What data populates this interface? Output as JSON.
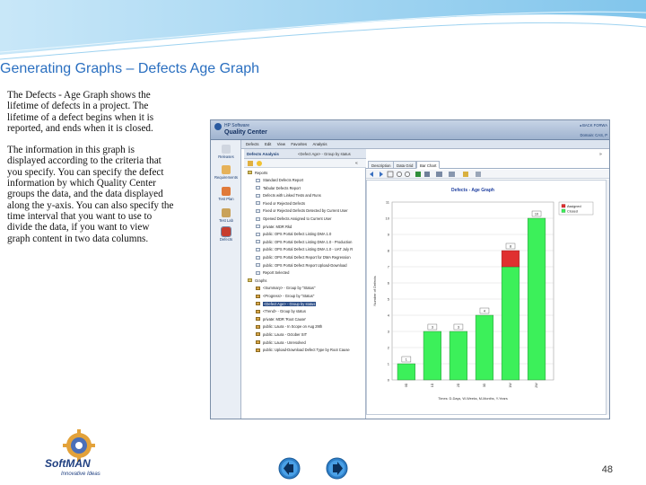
{
  "slide": {
    "title": "Generating Graphs – Defects Age Graph",
    "paragraphs": [
      "The Defects - Age Graph shows the lifetime of defects in a project. The lifetime of a defect begins when it is reported, and ends when it is closed.",
      "The information in this graph is displayed according to the criteria that you specify. You can specify the defect information by which Quality Center groups the data, and the data displayed along the y-axis. You can also specify the time interval that you want to use to divide the data, if you want to view graph content in two data columns."
    ],
    "page_number": "48",
    "logo_text": "SoftMAN",
    "logo_tagline": "Innovative Ideas"
  },
  "app": {
    "brand_small": "HP Software",
    "brand_large": "Quality Center",
    "nav_text": "◂ BACK   FORWA",
    "domain_text": "Domain: CAS, P",
    "sidebar": [
      "Releases",
      "Requirements",
      "Test Plan",
      "Test Lab",
      "Defects"
    ],
    "menubar": [
      "Defects",
      "Edit",
      "View",
      "Favorites",
      "Analysis"
    ],
    "left_pane": {
      "title": "Defects Analysis",
      "subtitle": "<Defect Age> - Group by status",
      "tree": [
        {
          "label": "Reports",
          "indent": 0,
          "kind": "folder",
          "selected": false
        },
        {
          "label": "Standard Defects Report",
          "indent": 1,
          "kind": "report",
          "selected": false
        },
        {
          "label": "Tabular Defects Report",
          "indent": 1,
          "kind": "report",
          "selected": false
        },
        {
          "label": "Defects with Linked Tests and Runs",
          "indent": 1,
          "kind": "report",
          "selected": false
        },
        {
          "label": "Fixed or Rejected Defects",
          "indent": 1,
          "kind": "report",
          "selected": false
        },
        {
          "label": "Fixed or Rejected Defects Detected by Current User",
          "indent": 1,
          "kind": "report",
          "selected": false
        },
        {
          "label": "Opened Defects Assigned to Current User",
          "indent": 1,
          "kind": "report",
          "selected": false
        },
        {
          "label": "private: MDR Rkd",
          "indent": 1,
          "kind": "report",
          "selected": false
        },
        {
          "label": "public: OPS Portal Defect Listing DMA 1.0",
          "indent": 1,
          "kind": "report",
          "selected": false
        },
        {
          "label": "public: OPS Portal Defect Listing DMA 1.0 - Production",
          "indent": 1,
          "kind": "report",
          "selected": false
        },
        {
          "label": "public: OPS Portal Defect Listing DMA 1.0 - UAT July R",
          "indent": 1,
          "kind": "report",
          "selected": false
        },
        {
          "label": "public: OPS Portal Defect Report for DMA Regression",
          "indent": 1,
          "kind": "report",
          "selected": false
        },
        {
          "label": "public: OPS Portal Defect Report Upload-Download",
          "indent": 1,
          "kind": "report",
          "selected": false
        },
        {
          "label": "Report Selected",
          "indent": 1,
          "kind": "report",
          "selected": false
        },
        {
          "label": "Graphs",
          "indent": 0,
          "kind": "folder",
          "selected": false
        },
        {
          "label": "<Summary> - Group by \"Status\"",
          "indent": 1,
          "kind": "graph",
          "selected": false
        },
        {
          "label": "<Progress> - Group by \"Status\"",
          "indent": 1,
          "kind": "graph",
          "selected": false
        },
        {
          "label": "<Defect Age> - Group by status",
          "indent": 1,
          "kind": "graph",
          "selected": true
        },
        {
          "label": "<Trend> - Group by status",
          "indent": 1,
          "kind": "graph",
          "selected": false
        },
        {
          "label": "private: MDR 'Root Cause'",
          "indent": 1,
          "kind": "graph",
          "selected": false
        },
        {
          "label": "public: Laura - In Scope on Aug 29th",
          "indent": 1,
          "kind": "graph",
          "selected": false
        },
        {
          "label": "public: Laura - October SIT",
          "indent": 1,
          "kind": "graph",
          "selected": false
        },
        {
          "label": "public: Laura - Unresolved",
          "indent": 1,
          "kind": "graph",
          "selected": false
        },
        {
          "label": "public: Upload-Download Defect Type by Root Cause",
          "indent": 1,
          "kind": "graph",
          "selected": false
        }
      ]
    },
    "tabs": [
      "Description",
      "Data Grid",
      "Bar Chart"
    ],
    "active_tab": 2,
    "colors": {
      "assigned": "#e03030",
      "closed": "#3cf05a",
      "accent": "#2a4c86"
    }
  },
  "chart_data": {
    "type": "bar",
    "title": "Defects - Age Graph",
    "ylabel": "Number of Defects",
    "xlabel": "Times: D-Days, W-Weeks, M-Months, Y-Years",
    "ylim": [
      0,
      11
    ],
    "yticks": [
      "0",
      "1",
      "2",
      "3",
      "4",
      "5",
      "6",
      "7",
      "8",
      "9",
      "10",
      "11"
    ],
    "categories": [
      "0D",
      "1D",
      "2D",
      "3D",
      "1W",
      "2W"
    ],
    "series": [
      {
        "name": "Assigned",
        "values": [
          0,
          0,
          0,
          0,
          1,
          0
        ]
      },
      {
        "name": "Closed",
        "values": [
          1,
          3,
          3,
          4,
          7,
          10
        ]
      }
    ],
    "totals": [
      "1",
      "3",
      "3",
      "4",
      "8",
      "10"
    ],
    "legend": "top-right"
  }
}
